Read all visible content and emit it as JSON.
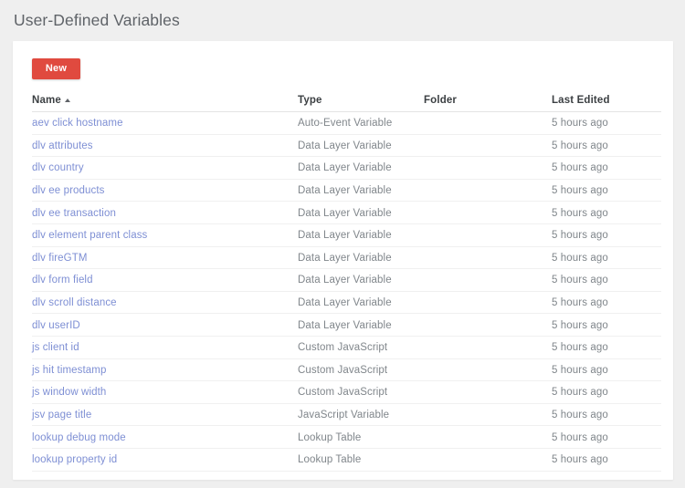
{
  "page": {
    "title": "User-Defined Variables"
  },
  "toolbar": {
    "new_label": "New"
  },
  "table": {
    "columns": {
      "name": "Name",
      "type": "Type",
      "folder": "Folder",
      "last_edited": "Last Edited"
    },
    "sort": {
      "column": "Name",
      "direction": "ascending",
      "icon": "sort-ascending-triangle-icon"
    },
    "rows": [
      {
        "name": "aev click hostname",
        "type": "Auto-Event Variable",
        "folder": "",
        "last_edited": "5 hours ago"
      },
      {
        "name": "dlv attributes",
        "type": "Data Layer Variable",
        "folder": "",
        "last_edited": "5 hours ago"
      },
      {
        "name": "dlv country",
        "type": "Data Layer Variable",
        "folder": "",
        "last_edited": "5 hours ago"
      },
      {
        "name": "dlv ee products",
        "type": "Data Layer Variable",
        "folder": "",
        "last_edited": "5 hours ago"
      },
      {
        "name": "dlv ee transaction",
        "type": "Data Layer Variable",
        "folder": "",
        "last_edited": "5 hours ago"
      },
      {
        "name": "dlv element parent class",
        "type": "Data Layer Variable",
        "folder": "",
        "last_edited": "5 hours ago"
      },
      {
        "name": "dlv fireGTM",
        "type": "Data Layer Variable",
        "folder": "",
        "last_edited": "5 hours ago"
      },
      {
        "name": "dlv form field",
        "type": "Data Layer Variable",
        "folder": "",
        "last_edited": "5 hours ago"
      },
      {
        "name": "dlv scroll distance",
        "type": "Data Layer Variable",
        "folder": "",
        "last_edited": "5 hours ago"
      },
      {
        "name": "dlv userID",
        "type": "Data Layer Variable",
        "folder": "",
        "last_edited": "5 hours ago"
      },
      {
        "name": "js client id",
        "type": "Custom JavaScript",
        "folder": "",
        "last_edited": "5 hours ago"
      },
      {
        "name": "js hit timestamp",
        "type": "Custom JavaScript",
        "folder": "",
        "last_edited": "5 hours ago"
      },
      {
        "name": "js window width",
        "type": "Custom JavaScript",
        "folder": "",
        "last_edited": "5 hours ago"
      },
      {
        "name": "jsv page title",
        "type": "JavaScript Variable",
        "folder": "",
        "last_edited": "5 hours ago"
      },
      {
        "name": "lookup debug mode",
        "type": "Lookup Table",
        "folder": "",
        "last_edited": "5 hours ago"
      },
      {
        "name": "lookup property id",
        "type": "Lookup Table",
        "folder": "",
        "last_edited": "5 hours ago"
      }
    ]
  },
  "colors": {
    "page_background": "#efefef",
    "card_background": "#ffffff",
    "new_button": "#e04a3f",
    "link": "#7e8fd4",
    "header_text": "#3c4043",
    "body_text": "#80868b",
    "title_text": "#5f6368"
  }
}
